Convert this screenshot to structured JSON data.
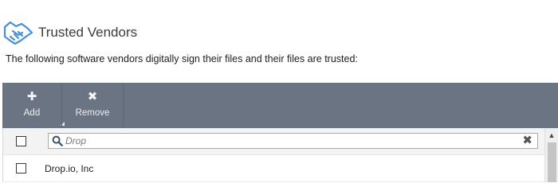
{
  "header": {
    "icon": "handshake-icon",
    "title": "Trusted Vendors"
  },
  "description": "The following software vendors digitally sign their files and their files are trusted:",
  "toolbar": {
    "add": {
      "icon": "plus-icon",
      "label": "Add"
    },
    "remove": {
      "icon": "close-icon",
      "label": "Remove"
    },
    "colors": {
      "background": "#6b7482"
    }
  },
  "filter": {
    "search_icon": "search-icon",
    "value": "Drop",
    "clear_icon": "clear-icon"
  },
  "vendors": [
    {
      "name": "Drop.io, Inc",
      "checked": false
    }
  ]
}
